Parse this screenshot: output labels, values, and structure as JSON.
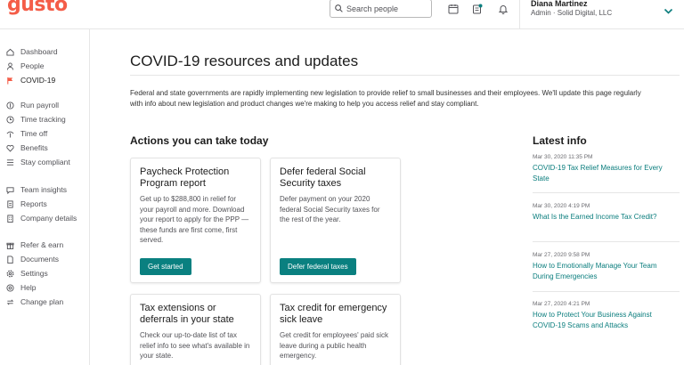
{
  "brand": {
    "logo_text": "gusto",
    "accent": "#f45d48",
    "teal": "#0a8080"
  },
  "search": {
    "placeholder": "Search people",
    "value": ""
  },
  "header_icons": [
    "calendar-icon",
    "notifications-panel-icon",
    "bell-icon"
  ],
  "user": {
    "name": "Diana Martinez",
    "role": "Admin · Solid Digital, LLC",
    "menu_icon": "chevron-down-icon"
  },
  "sidebar": {
    "items": [
      {
        "label": "Dashboard",
        "icon": "home-icon"
      },
      {
        "label": "People",
        "icon": "people-icon"
      },
      {
        "label": "COVID-19",
        "icon": "flag-icon",
        "active": true
      },
      {
        "label": "Run payroll",
        "icon": "payroll-icon"
      },
      {
        "label": "Time tracking",
        "icon": "clock-icon"
      },
      {
        "label": "Time off",
        "icon": "palm-icon"
      },
      {
        "label": "Benefits",
        "icon": "heart-icon"
      },
      {
        "label": "Stay compliant",
        "icon": "list-icon"
      },
      {
        "label": "Team insights",
        "icon": "chat-icon"
      },
      {
        "label": "Reports",
        "icon": "report-icon"
      },
      {
        "label": "Company details",
        "icon": "building-icon"
      },
      {
        "label": "Refer & earn",
        "icon": "gift-icon"
      },
      {
        "label": "Documents",
        "icon": "document-icon"
      },
      {
        "label": "Settings",
        "icon": "gear-icon"
      },
      {
        "label": "Help",
        "icon": "help-icon"
      },
      {
        "label": "Change plan",
        "icon": "change-plan-icon"
      }
    ]
  },
  "main": {
    "title": "COVID-19 resources and updates",
    "intro": "Federal and state governments are rapidly implementing new legislation to provide relief to small businesses and their employees. We'll update this page regularly with info about new legislation and product changes we're making to help you access relief and stay compliant.",
    "actions_title": "Actions you can take today",
    "cards": [
      {
        "title": "Paycheck Protection Program report",
        "body": "Get up to $288,800 in relief for your payroll and more. Download your report to apply for the PPP — these funds are first come, first served.",
        "button": "Get started"
      },
      {
        "title": "Defer federal Social Security taxes",
        "body": "Defer payment on your 2020 federal Social Security taxes for the rest of the year.",
        "button": "Defer federal taxes"
      },
      {
        "title": "Tax extensions or deferrals in your state",
        "body": "Check our up-to-date list of tax relief info to see what's available in your state."
      },
      {
        "title": "Tax credit for emergency sick leave",
        "body": "Get credit for employees' paid sick leave during a public health emergency."
      }
    ],
    "latest_title": "Latest info",
    "latest": [
      {
        "date": "Mar 30, 2020 11:35 PM",
        "title": "COVID-19 Tax Relief Measures for Every State"
      },
      {
        "date": "Mar 30, 2020 4:19 PM",
        "title": "What Is the Earned Income Tax Credit?"
      },
      {
        "date": "Mar 27, 2020 9:58 PM",
        "title": "How to Emotionally Manage Your Team During Emergencies"
      },
      {
        "date": "Mar 27, 2020 4:21 PM",
        "title": "How to Protect Your Business Against COVID-19 Scams and Attacks"
      }
    ]
  }
}
